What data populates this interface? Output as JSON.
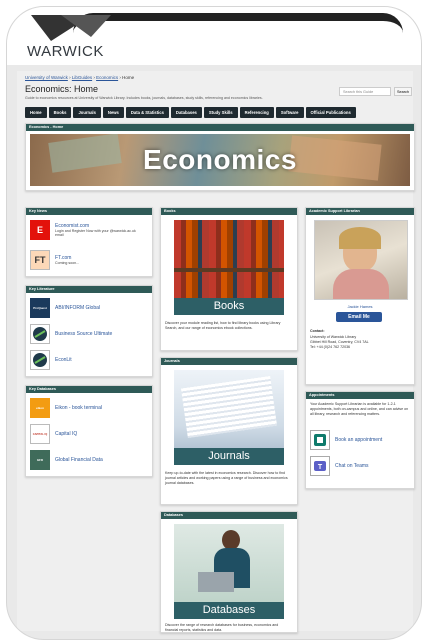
{
  "brand": {
    "logo_text": "WARWICK"
  },
  "breadcrumb": [
    "University of Warwick",
    "LibGuides",
    "Economics",
    "Home"
  ],
  "page": {
    "title": "Economics: Home",
    "description": "Guide to economics resources at University of Warwick Library. Includes books, journals, databases, study skills, referencing and economics libraries."
  },
  "search": {
    "placeholder": "Search this Guide",
    "button": "Search"
  },
  "nav": [
    "Home",
    "Books",
    "Journals",
    "News",
    "Data & Statistics",
    "Databases",
    "Study Skills",
    "Referencing",
    "Software",
    "Official Publications"
  ],
  "banner": {
    "header": "Economics - Home",
    "title": "Economics"
  },
  "key_news": {
    "header": "Key News",
    "items": [
      {
        "icon": "E",
        "label": "Economist.com",
        "sub": "Login and Register Now with your @warwick.ac.uk email"
      },
      {
        "icon": "FT",
        "label": "FT.com",
        "sub": "Coming soon..."
      }
    ]
  },
  "key_literature": {
    "header": "Key Literature",
    "items": [
      {
        "icon": "ProQuest",
        "label": "ABI/INFORM Global"
      },
      {
        "icon": "EBSCO",
        "label": "Business Source Ultimate"
      },
      {
        "icon": "EBSCO",
        "label": "EconLit"
      }
    ]
  },
  "key_databases": {
    "header": "Key Databases",
    "items": [
      {
        "icon": "eikon",
        "label": "Eikon - book terminal"
      },
      {
        "icon": "CAPITAL IQ",
        "label": "Capital IQ"
      },
      {
        "icon": "GFD",
        "label": "Global Financial Data"
      }
    ]
  },
  "books": {
    "header": "Books",
    "cover": "Books",
    "text": "Discover your module reading list, how to find library books using Library Search, and our range of economics ebook collections."
  },
  "journals": {
    "header": "Journals",
    "cover": "Journals",
    "text": "Keep up-to-date with the latest in economics research. Discover how to find journal articles and working papers using a range of business and economics journal databases."
  },
  "databases": {
    "header": "Databases",
    "cover": "Databases",
    "text": "Discover the range of research databases for business, economics and financial reports, statistics and data."
  },
  "support": {
    "header": "Academic Support Librarian",
    "name": "Jackie Hames",
    "email_button": "Email Me",
    "contact_label": "Contact:",
    "contact": [
      "University of Warwick Library",
      "Gibbet Hill Road, Coventry, CV4 7AL",
      "Tel: +44 (0)24 762 72036"
    ]
  },
  "appointments": {
    "header": "Appointments",
    "text": "Your Academic Support Librarian is available for 1-2-1 appointments, both on-campus and online, and can advise on all library, research and referencing matters.",
    "items": [
      "Book an appointment",
      "Chat on Teams"
    ]
  }
}
